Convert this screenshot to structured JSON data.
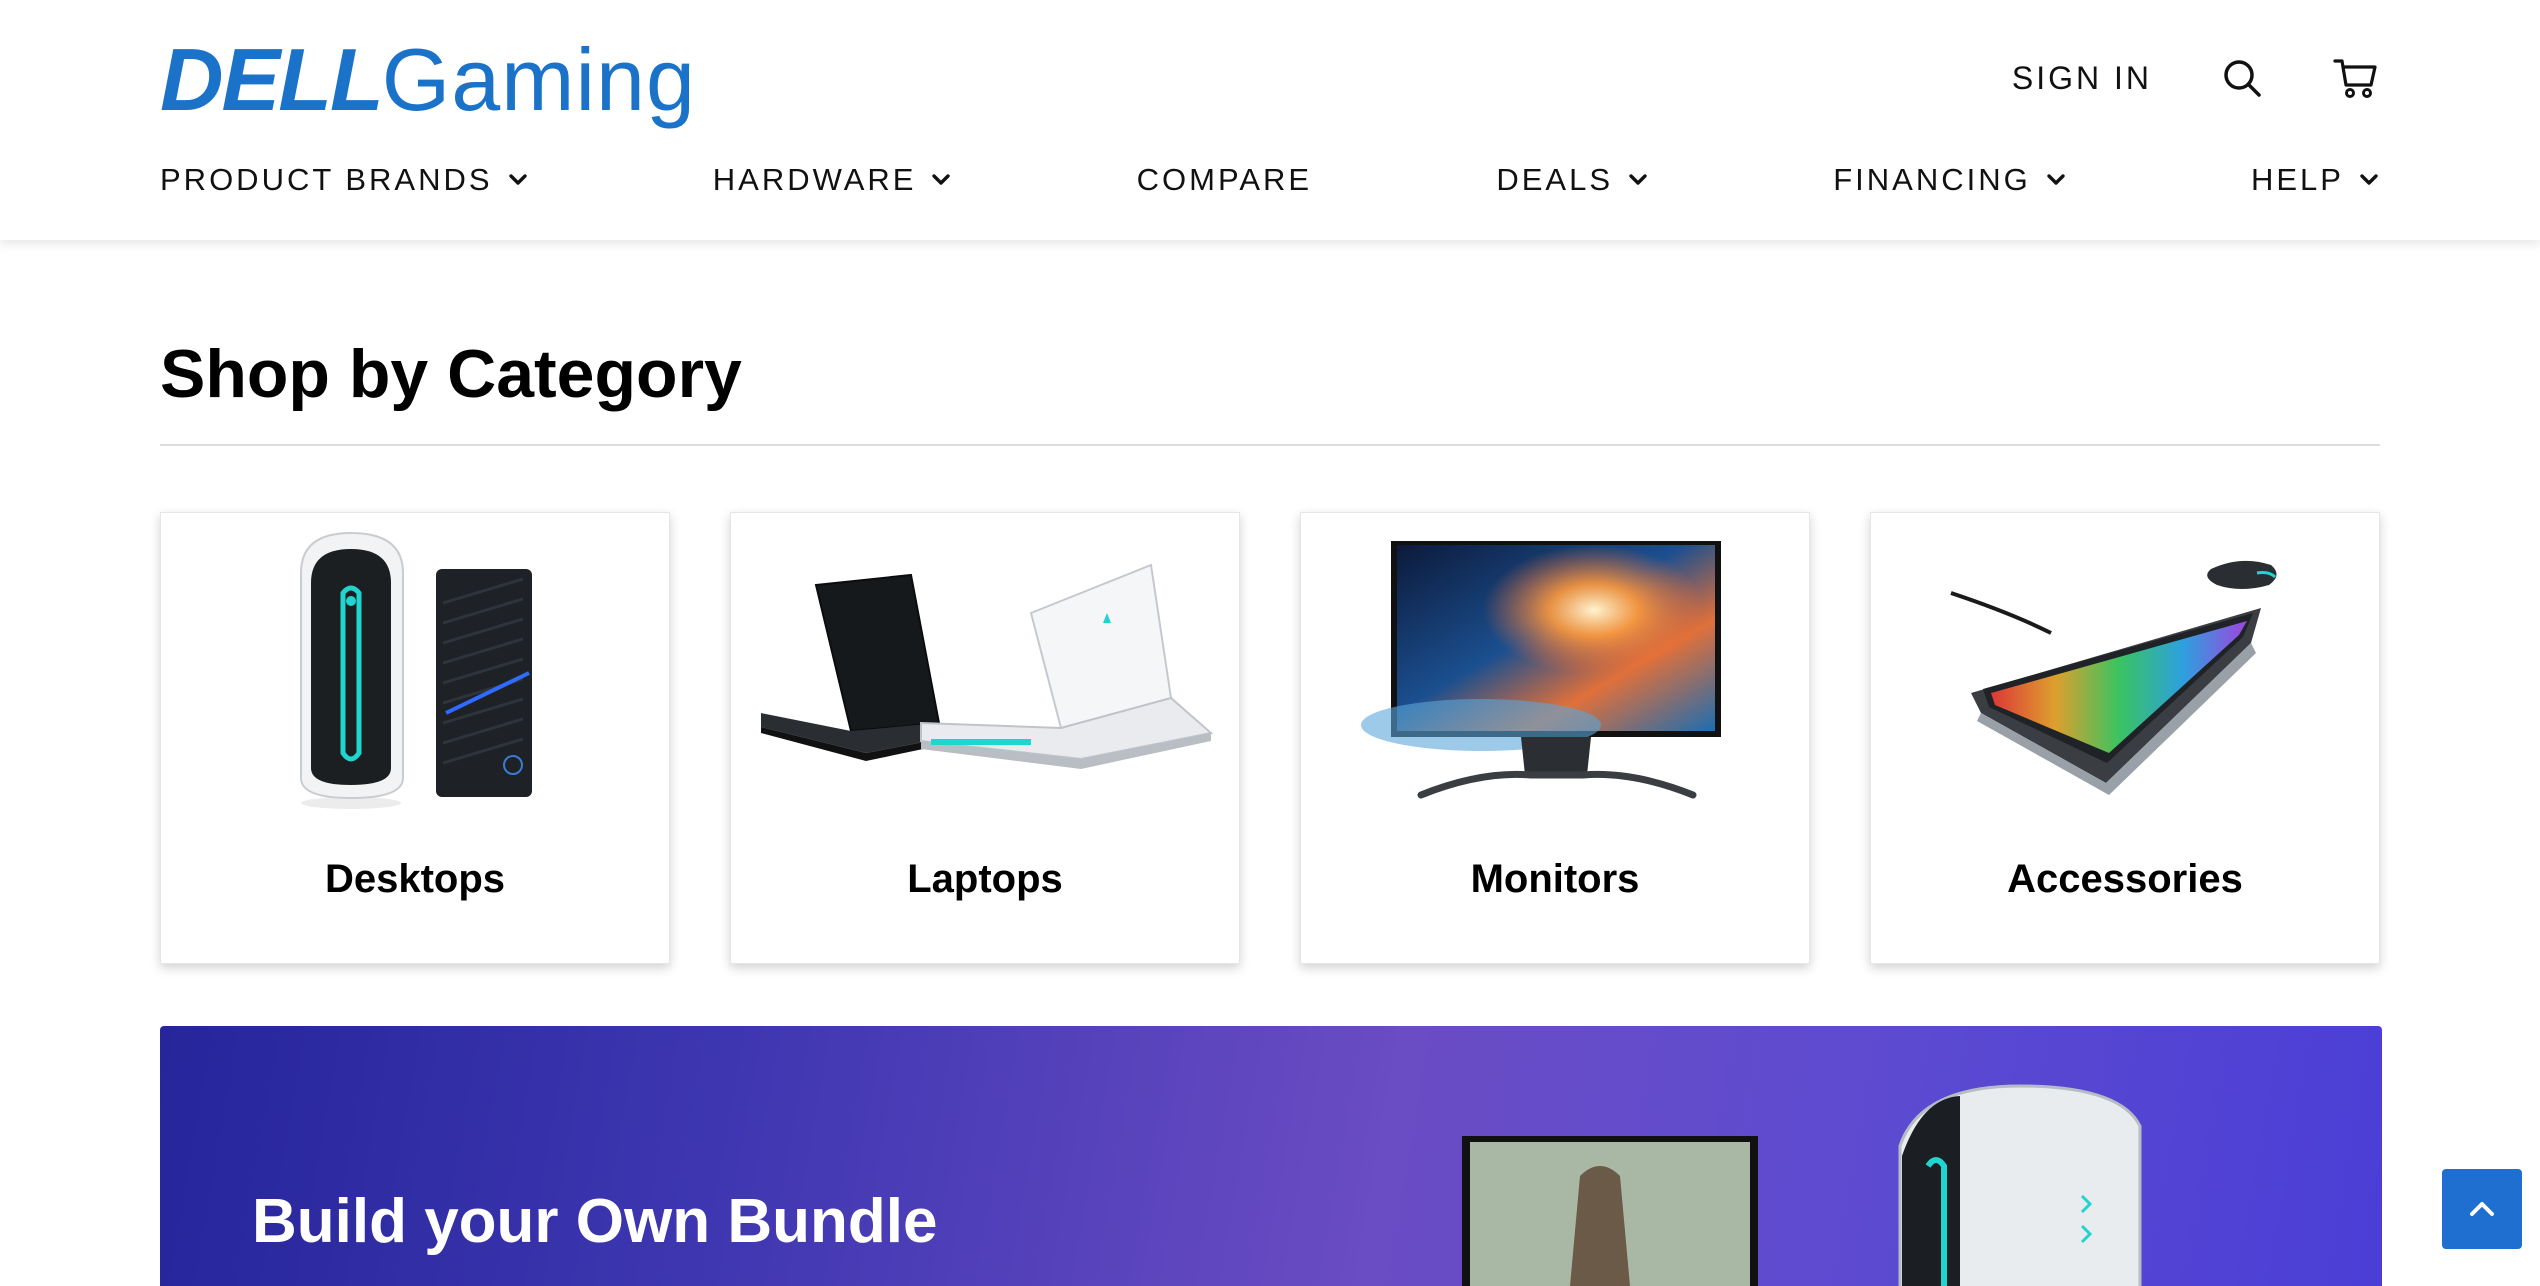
{
  "brand": {
    "logo_dell": "DELL",
    "logo_gaming": "Gaming",
    "color": "#1a73c8"
  },
  "header": {
    "signin_label": "SIGN IN",
    "search_icon": "search-icon",
    "cart_icon": "cart-icon"
  },
  "nav": {
    "items": [
      {
        "label": "PRODUCT BRANDS",
        "has_dropdown": true
      },
      {
        "label": "HARDWARE",
        "has_dropdown": true
      },
      {
        "label": "COMPARE",
        "has_dropdown": false
      },
      {
        "label": "DEALS",
        "has_dropdown": true
      },
      {
        "label": "FINANCING",
        "has_dropdown": true
      },
      {
        "label": "HELP",
        "has_dropdown": true
      }
    ]
  },
  "main": {
    "section_title": "Shop by Category",
    "categories": [
      {
        "label": "Desktops"
      },
      {
        "label": "Laptops"
      },
      {
        "label": "Monitors"
      },
      {
        "label": "Accessories"
      }
    ],
    "banner": {
      "title": "Build your Own Bundle"
    }
  },
  "colors": {
    "accent": "#1e6fd0",
    "banner_start": "#26259a",
    "banner_end": "#4a3ed6"
  }
}
